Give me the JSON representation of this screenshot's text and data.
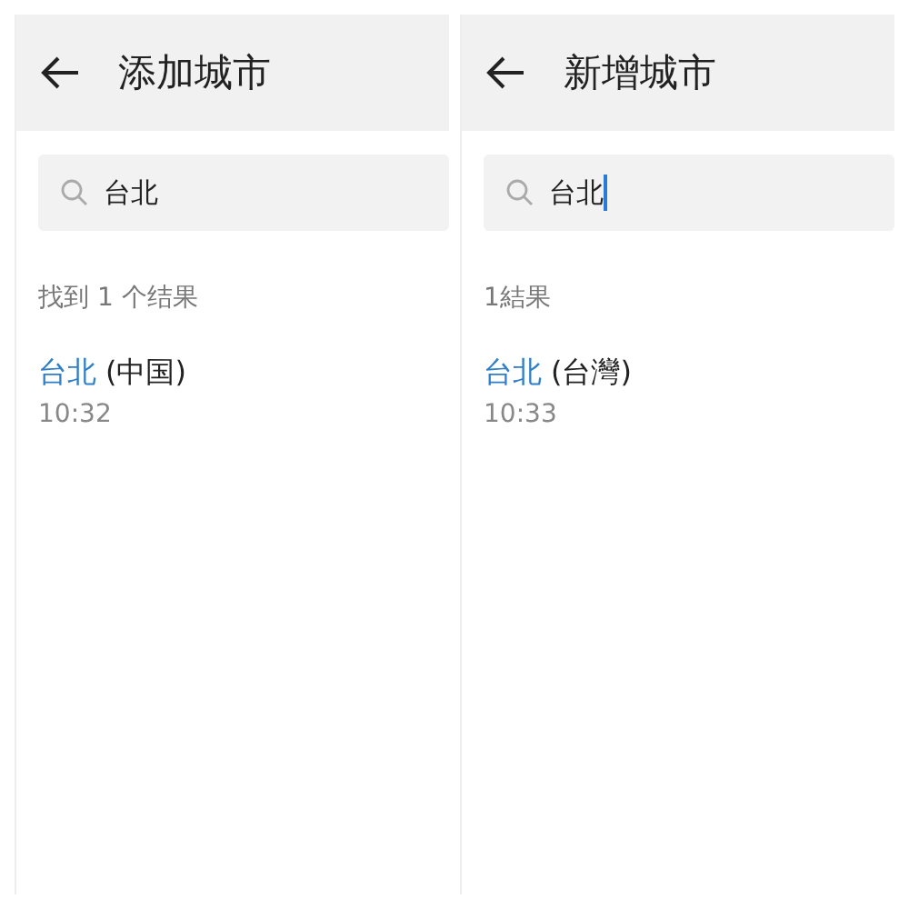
{
  "panels": [
    {
      "title": "添加城市",
      "search": {
        "value": "台北",
        "focused": false
      },
      "result_count": "找到 1 个结果",
      "results": [
        {
          "match": "台北",
          "region": "(中国)",
          "time": "10:32"
        }
      ]
    },
    {
      "title": "新增城市",
      "search": {
        "value": "台北",
        "focused": true
      },
      "result_count": "1結果",
      "results": [
        {
          "match": "台北",
          "region": "(台灣)",
          "time": "10:33"
        }
      ]
    }
  ]
}
